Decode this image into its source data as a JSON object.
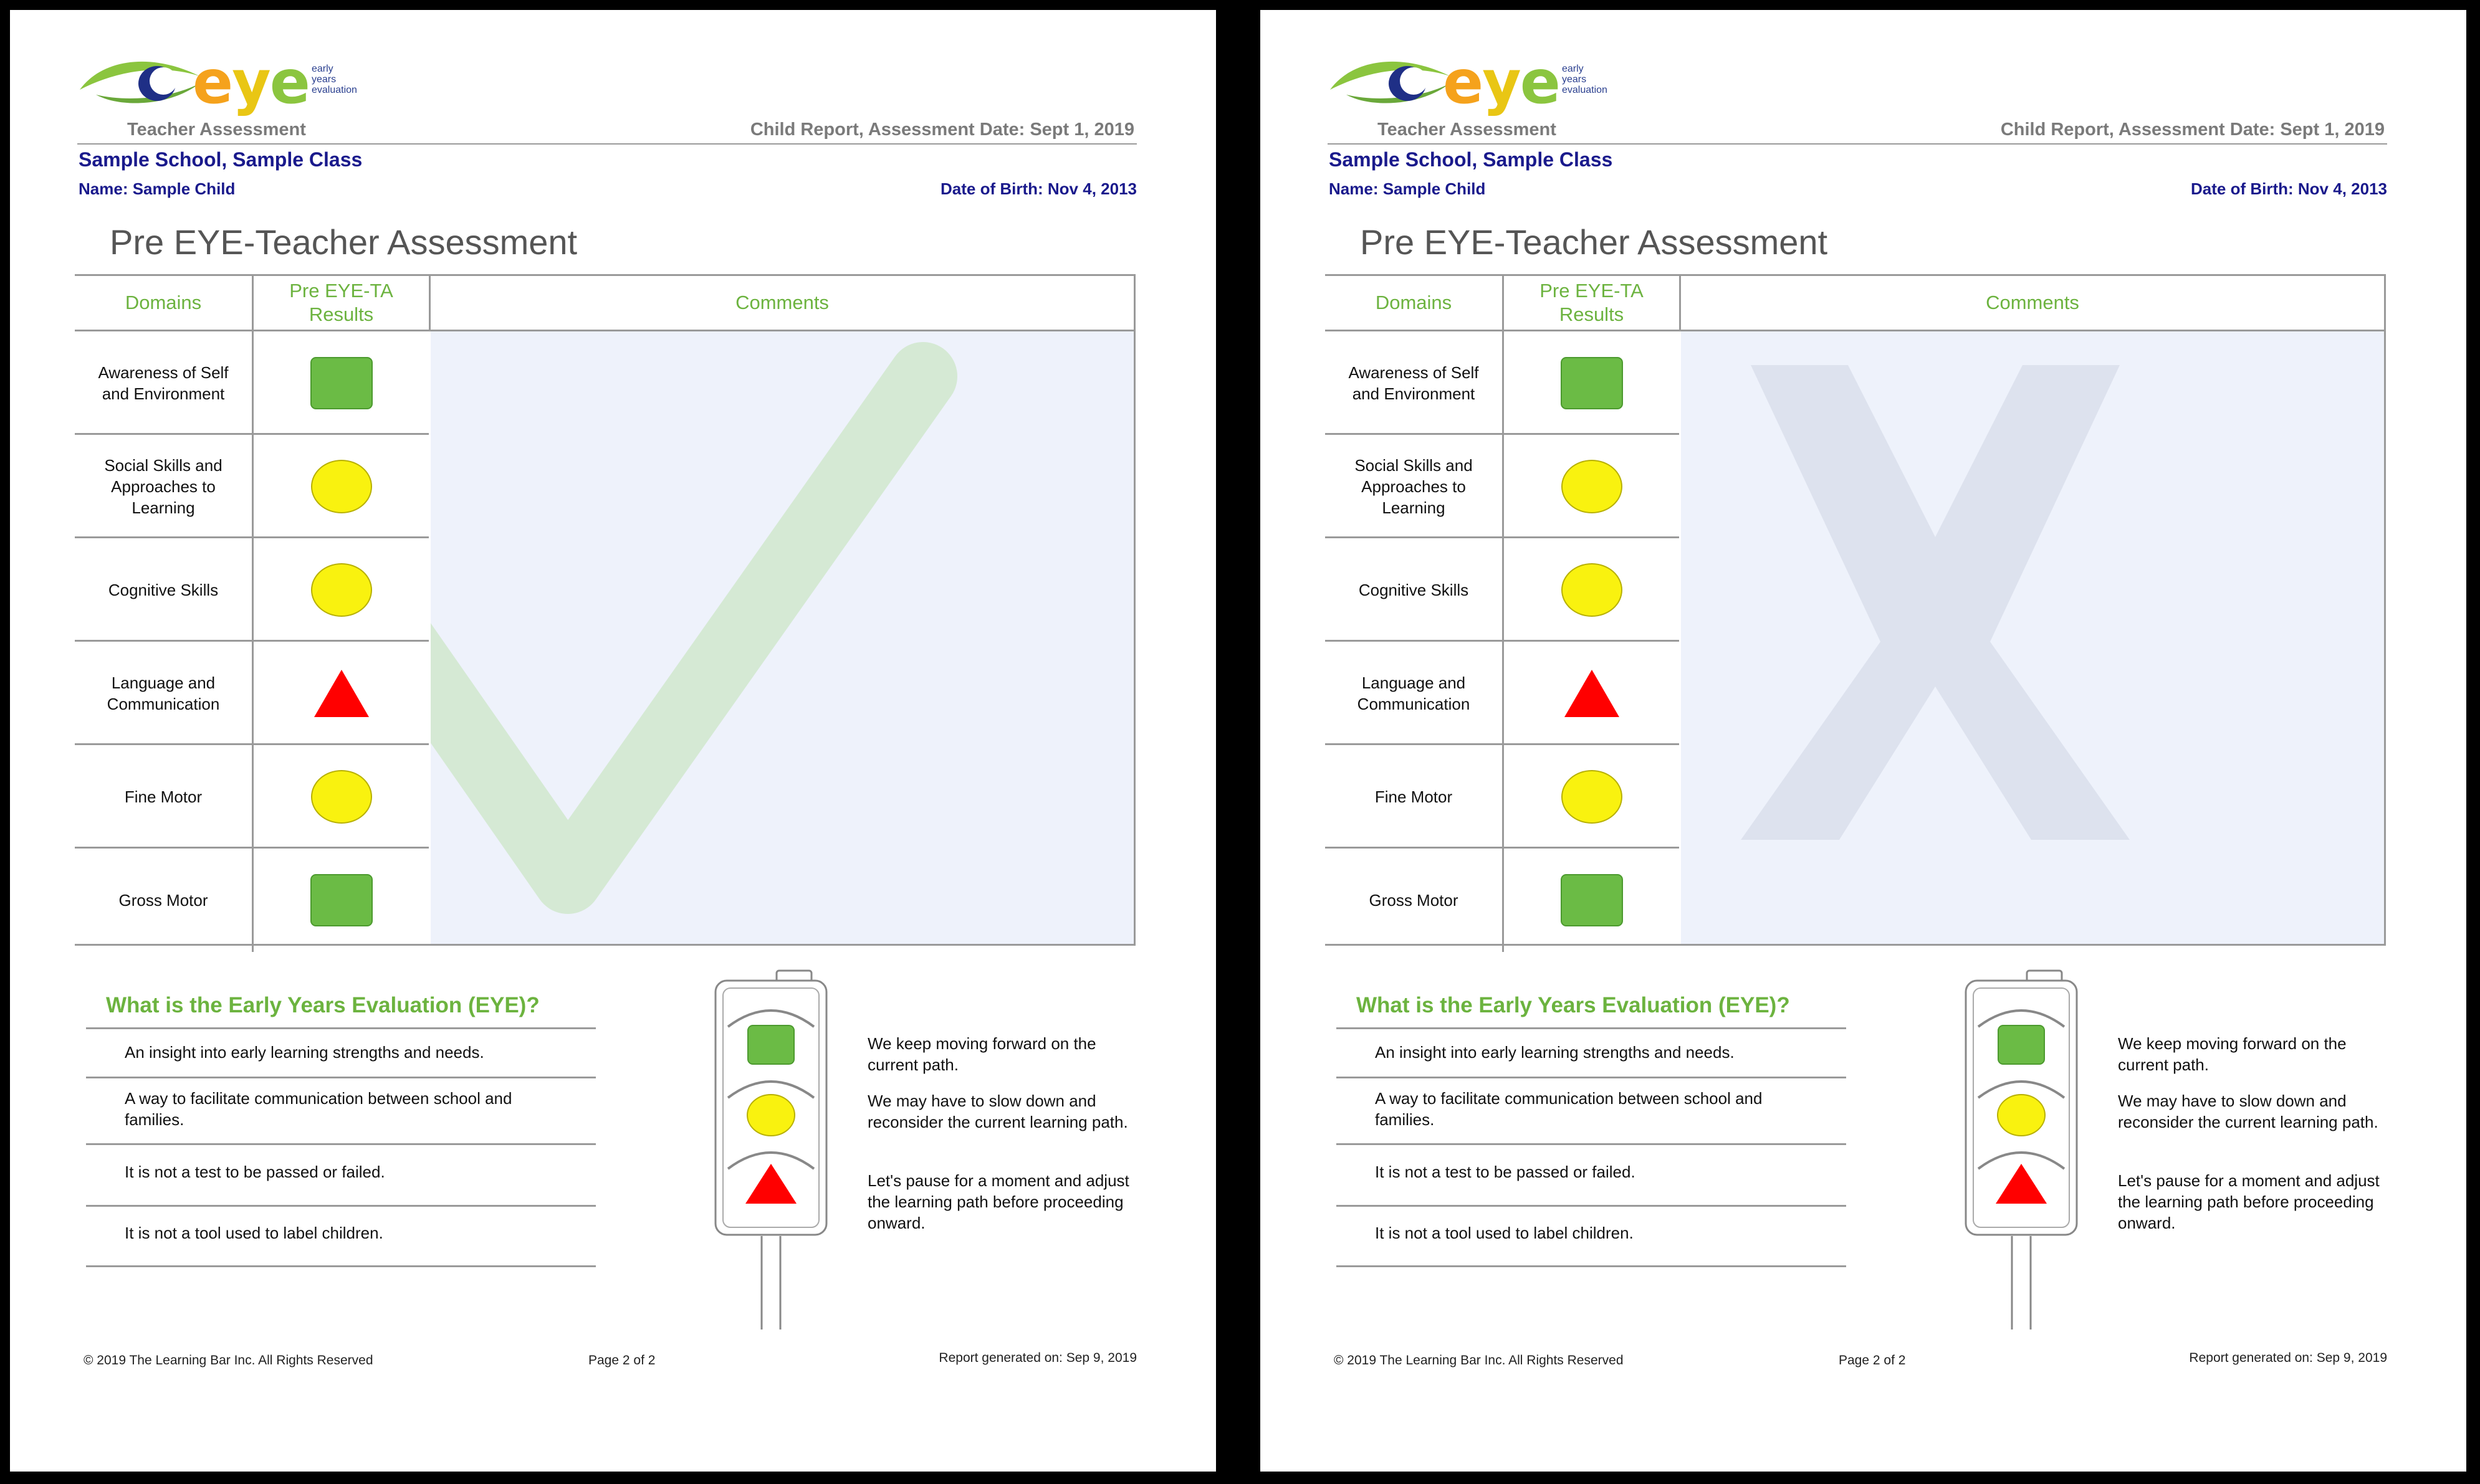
{
  "pages": [
    {
      "logo": {
        "word": "eye",
        "tagline": [
          "early",
          "years",
          "evaluation"
        ]
      },
      "header": {
        "left": "Teacher Assessment",
        "right": "Child Report, Assessment Date: Sept 1, 2019"
      },
      "school": "Sample School, Sample Class",
      "child_name": "Name: Sample Child",
      "dob": "Date of Birth: Nov 4, 2013",
      "title": "Pre EYE-Teacher Assessment",
      "table": {
        "headers": [
          "Domains",
          "Pre EYE-TA Results",
          "Comments"
        ],
        "rows": [
          {
            "domain": "Awareness of Self and Environment",
            "result": "green-square"
          },
          {
            "domain": "Social Skills and Approaches to Learning",
            "result": "yellow-circle"
          },
          {
            "domain": "Cognitive Skills",
            "result": "yellow-circle"
          },
          {
            "domain": "Language and Communication",
            "result": "red-triangle"
          },
          {
            "domain": "Fine Motor",
            "result": "yellow-circle"
          },
          {
            "domain": "Gross Motor",
            "result": "green-square"
          }
        ],
        "watermark": "checkmark-icon"
      },
      "info": {
        "title": "What is the Early Years Evaluation (EYE)?",
        "items": [
          "An insight into early learning strengths and needs.",
          "A way to facilitate communication between school and families.",
          "It is not a test to be passed or failed.",
          "It is not a tool used to label children."
        ]
      },
      "legend": [
        "We keep moving forward on the current path.",
        "We may have to slow down and reconsider the current learning path.",
        "Let's pause for a moment and adjust the learning path before proceeding onward."
      ],
      "footer": {
        "copyright": "© 2019 The Learning Bar Inc. All Rights Reserved",
        "page": "Page 2 of 2",
        "generated": "Report generated on: Sep 9, 2019"
      }
    },
    {
      "logo": {
        "word": "eye",
        "tagline": [
          "early",
          "years",
          "evaluation"
        ]
      },
      "header": {
        "left": "Teacher Assessment",
        "right": "Child Report, Assessment Date: Sept 1, 2019"
      },
      "school": "Sample School, Sample Class",
      "child_name": "Name: Sample Child",
      "dob": "Date of Birth: Nov 4, 2013",
      "title": "Pre EYE-Teacher Assessment",
      "table": {
        "headers": [
          "Domains",
          "Pre EYE-TA Results",
          "Comments"
        ],
        "rows": [
          {
            "domain": "Awareness of Self and Environment",
            "result": "green-square"
          },
          {
            "domain": "Social Skills and Approaches to Learning",
            "result": "yellow-circle"
          },
          {
            "domain": "Cognitive Skills",
            "result": "yellow-circle"
          },
          {
            "domain": "Language and Communication",
            "result": "red-triangle"
          },
          {
            "domain": "Fine Motor",
            "result": "yellow-circle"
          },
          {
            "domain": "Gross Motor",
            "result": "green-square"
          }
        ],
        "watermark": "x-mark-icon"
      },
      "info": {
        "title": "What is the Early Years Evaluation (EYE)?",
        "items": [
          "An insight into early learning strengths and needs.",
          "A way to facilitate communication between school and families.",
          "It is not a test to be passed or failed.",
          "It is not a tool used to label children."
        ]
      },
      "legend": [
        "We keep moving forward on the current path.",
        "We may have to slow down and reconsider the current learning path.",
        "Let's pause for a moment and adjust the learning path before proceeding onward."
      ],
      "footer": {
        "copyright": "© 2019 The Learning Bar Inc. All Rights Reserved",
        "page": "Page 2 of 2",
        "generated": "Report generated on: Sep 9, 2019"
      }
    }
  ],
  "colors": {
    "green": "#6bbb45",
    "yellow": "#f9f20f",
    "red": "#ff0000",
    "navy": "#1a1a8c",
    "header_green": "#6cb33f"
  }
}
